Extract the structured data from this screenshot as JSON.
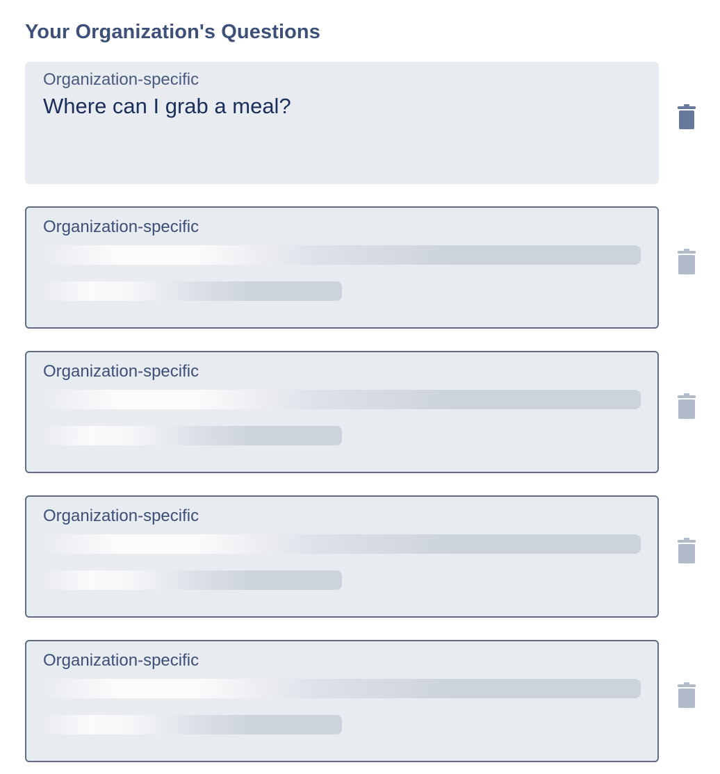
{
  "section": {
    "title": "Your Organization's Questions"
  },
  "questions": [
    {
      "category": "Organization-specific",
      "text": "Where can I grab a meal?",
      "loading": false,
      "delete_icon": "trash-icon"
    },
    {
      "category": "Organization-specific",
      "text": "",
      "loading": true,
      "delete_icon": "trash-icon"
    },
    {
      "category": "Organization-specific",
      "text": "",
      "loading": true,
      "delete_icon": "trash-icon"
    },
    {
      "category": "Organization-specific",
      "text": "",
      "loading": true,
      "delete_icon": "trash-icon"
    },
    {
      "category": "Organization-specific",
      "text": "",
      "loading": true,
      "delete_icon": "trash-icon"
    }
  ],
  "colors": {
    "heading": "#3d5078",
    "card_background": "#e8ebf0",
    "card_border": "#5f6b82",
    "question_text": "#1a2e5c",
    "trash_active": "#66789b",
    "trash_disabled": "#b1bac9"
  }
}
